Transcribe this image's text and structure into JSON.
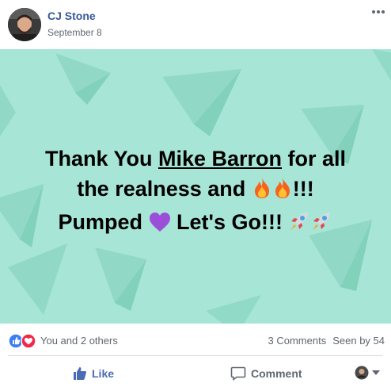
{
  "post": {
    "author_name": "CJ Stone",
    "date": "September 8",
    "more_icon": "more-horizontal-icon"
  },
  "banner": {
    "background_color": "#a7e5d6",
    "text_prefix": "Thank You ",
    "mention": "Mike Barron",
    "text_suffix": " for all",
    "line2_text": "the realness and ",
    "line2_end": "!!!",
    "line3_start": "Pumped ",
    "line3_mid": " Let's Go!!! ",
    "emojis": [
      "fire",
      "fire",
      "purple-heart",
      "rocket",
      "rocket"
    ]
  },
  "reactions": {
    "icons": [
      "like-reaction-icon",
      "love-reaction-icon"
    ],
    "summary": "You and 2 others",
    "comments": "3 Comments",
    "seen_by": "Seen by 54"
  },
  "actions": {
    "like_label": "Like",
    "comment_label": "Comment",
    "like_color": "#4b6bb5"
  }
}
